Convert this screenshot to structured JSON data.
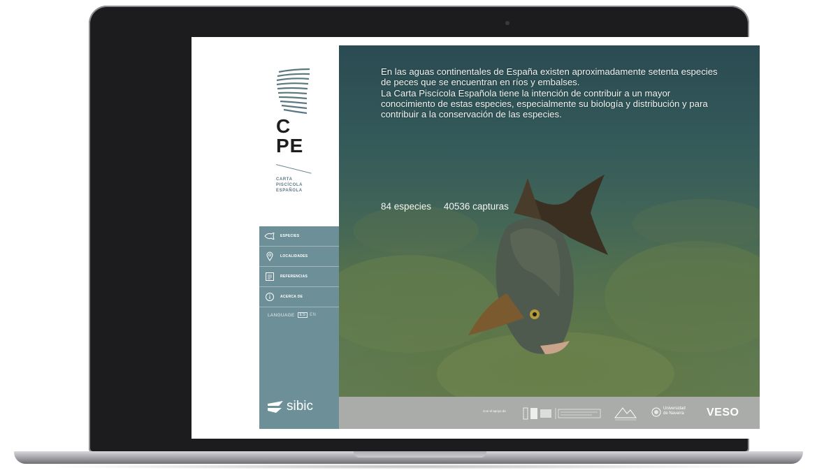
{
  "sidebar": {
    "logo": {
      "initials_top": "C",
      "initials_bottom": "PE",
      "subtitle": [
        "CARTA",
        "PISCÍCOLA",
        "ESPAÑOLA"
      ]
    },
    "nav": [
      {
        "label": "ESPECIES",
        "icon": "fish-icon"
      },
      {
        "label": "LOCALIDADES",
        "icon": "location-pin-icon"
      },
      {
        "label": "REFERENCIAS",
        "icon": "book-icon"
      },
      {
        "label": "ACERCA DE",
        "icon": "info-icon"
      }
    ],
    "language": {
      "label": "LANGUAGE",
      "selected": "ES",
      "other": "EN"
    },
    "brand": "sibic"
  },
  "main": {
    "intro": [
      "En las aguas continentales de España existen aproximadamente setenta especies de peces que se encuentran en ríos y embalses.",
      "La Carta Piscícola Española tiene la intención de contribuir a un mayor conocimiento de estas especies, especialmente su biología y distribución y para contribuir a la conservación de las especies."
    ],
    "stats": {
      "species": "84 especies",
      "captures": "40536 capturas"
    }
  },
  "footer": {
    "funded_label": "Con el apoyo de",
    "partners": [
      "Universidad de Navarra",
      "VESO"
    ]
  },
  "colors": {
    "sidebar": "#6c8f98",
    "footer": "#a9aca8",
    "logo_stripes": "#5b7881"
  }
}
